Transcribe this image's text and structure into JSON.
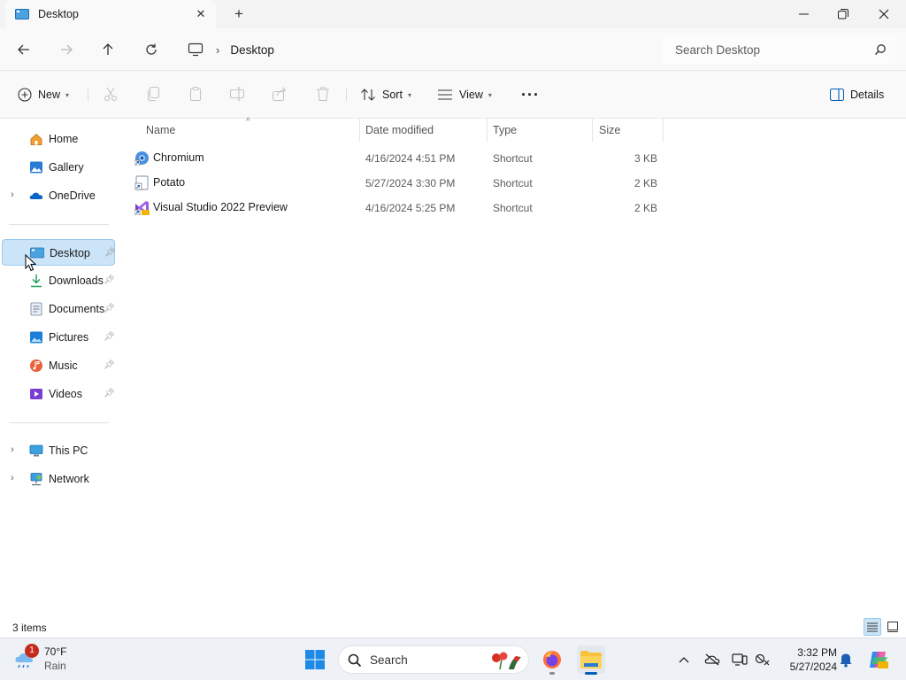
{
  "window": {
    "tab_title": "Desktop",
    "new_tab_label": "+"
  },
  "address": {
    "breadcrumb": "Desktop",
    "search_placeholder": "Search Desktop"
  },
  "toolbar": {
    "new_label": "New",
    "sort_label": "Sort",
    "view_label": "View",
    "more_label": "···",
    "details_label": "Details"
  },
  "sidebar": {
    "items": [
      {
        "label": "Home",
        "icon": "home-icon"
      },
      {
        "label": "Gallery",
        "icon": "gallery-icon"
      },
      {
        "label": "OneDrive",
        "icon": "onedrive-icon"
      },
      {
        "label": "Desktop",
        "icon": "desktop-icon",
        "selected": true
      },
      {
        "label": "Downloads",
        "icon": "downloads-icon"
      },
      {
        "label": "Documents",
        "icon": "documents-icon"
      },
      {
        "label": "Pictures",
        "icon": "pictures-icon"
      },
      {
        "label": "Music",
        "icon": "music-icon"
      },
      {
        "label": "Videos",
        "icon": "videos-icon"
      },
      {
        "label": "This PC",
        "icon": "this-pc-icon"
      },
      {
        "label": "Network",
        "icon": "network-icon"
      }
    ]
  },
  "files": {
    "columns": [
      "Name",
      "Date modified",
      "Type",
      "Size"
    ],
    "rows": [
      {
        "name": "Chromium",
        "date": "4/16/2024 4:51 PM",
        "type": "Shortcut",
        "size": "3 KB",
        "icon": "chromium-icon"
      },
      {
        "name": "Potato",
        "date": "5/27/2024 3:30 PM",
        "type": "Shortcut",
        "size": "2 KB",
        "icon": "potato-shortcut-icon"
      },
      {
        "name": "Visual Studio 2022 Preview",
        "date": "4/16/2024 5:25 PM",
        "type": "Shortcut",
        "size": "2 KB",
        "icon": "visual-studio-icon"
      }
    ]
  },
  "status": {
    "item_count": "3 items"
  },
  "taskbar": {
    "weather_badge": "1",
    "weather_temp": "70°F",
    "weather_condition": "Rain",
    "search_label": "Search",
    "time": "3:32 PM",
    "date": "5/27/2024"
  },
  "colors": {
    "accent": "#005fb8",
    "selection": "#cce4f7",
    "selection_border": "#99c9ef",
    "folder_yellow": "#f8c33a"
  }
}
